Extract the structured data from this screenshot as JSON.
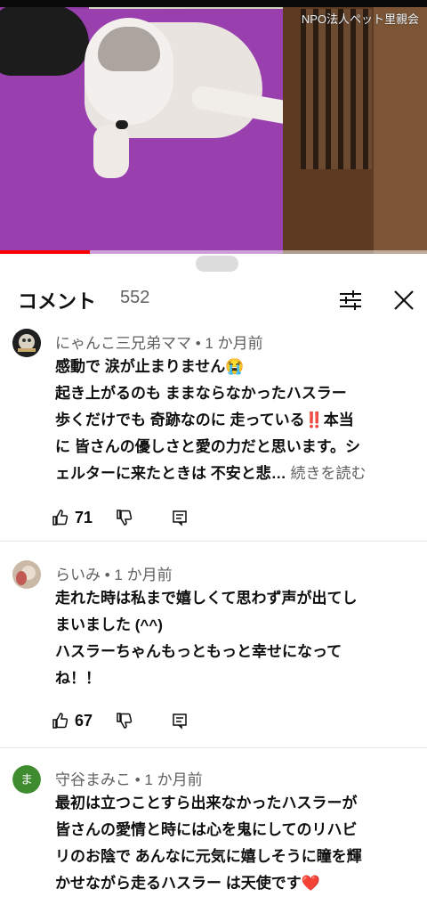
{
  "video": {
    "watermark": "NPO法人ペット里親会",
    "progress_fraction": 0.21
  },
  "comments_panel": {
    "title": "コメント",
    "count": "552"
  },
  "comments": [
    {
      "author": "にゃんこ三兄弟ママ • 1 か月前",
      "lines": [
        "感動で 涙が止まりません😭",
        "起き上がるのも ままならなかったハスラー",
        "歩くだけでも 奇跡なのに 走っている‼️本当",
        "に 皆さんの優しさと愛の力だと思います。シ",
        "ェルターに来たときは 不安と悲…"
      ],
      "read_more": "続きを読む",
      "likes": "71"
    },
    {
      "author": "らいみ • 1 か月前",
      "lines": [
        "走れた時は私まで嬉しくて思わず声が出てし",
        "まいました (^^)",
        "ハスラーちゃんもっともっと幸せになって",
        "ね！！"
      ],
      "likes": "67"
    },
    {
      "author": "守谷まみこ • 1 か月前",
      "avatar_letter": "ま",
      "lines": [
        "最初は立つことすら出来なかったハスラーが",
        "皆さんの愛情と時には心を鬼にしてのリハビ",
        "リのお陰で あんなに元気に嬉しそうに瞳を輝",
        "かせながら走るハスラー は天使です❤️"
      ]
    }
  ],
  "colors": {
    "progress": "#ff0000",
    "avatar3": "#3f8b2f"
  }
}
